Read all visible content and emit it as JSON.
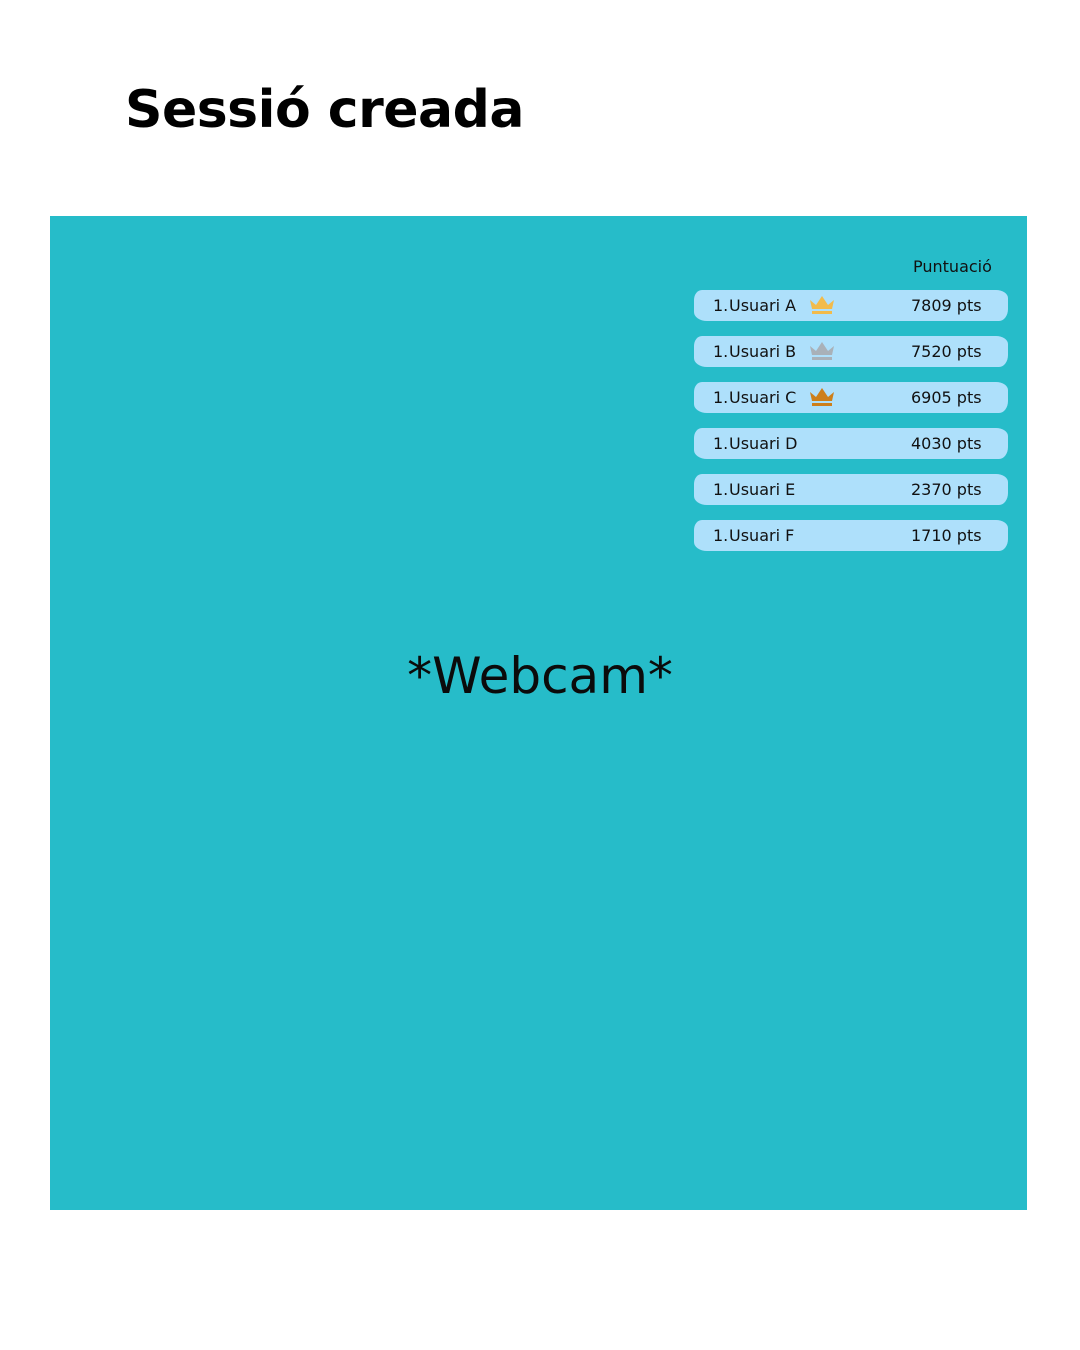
{
  "page": {
    "title": "Sessió creada"
  },
  "webcam": {
    "label": "*Webcam*",
    "background_color": "#26bcc9"
  },
  "scoreboard": {
    "header": "Puntuació",
    "row_color": "#aee0fb",
    "rows": [
      {
        "rank": "1.",
        "name": "Usuari A",
        "score": "7809 pts",
        "crown": "gold-crown-icon",
        "crown_color": "#f2bb4a"
      },
      {
        "rank": "1.",
        "name": "Usuari B",
        "score": "7520 pts",
        "crown": "silver-crown-icon",
        "crown_color": "#a9b1b8"
      },
      {
        "rank": "1.",
        "name": "Usuari C",
        "score": "6905 pts",
        "crown": "bronze-crown-icon",
        "crown_color": "#cd7f1a"
      },
      {
        "rank": "1.",
        "name": "Usuari D",
        "score": "4030 pts"
      },
      {
        "rank": "1.",
        "name": "Usuari E",
        "score": "2370 pts"
      },
      {
        "rank": "1.",
        "name": "Usuari F",
        "score": "1710 pts"
      }
    ]
  }
}
